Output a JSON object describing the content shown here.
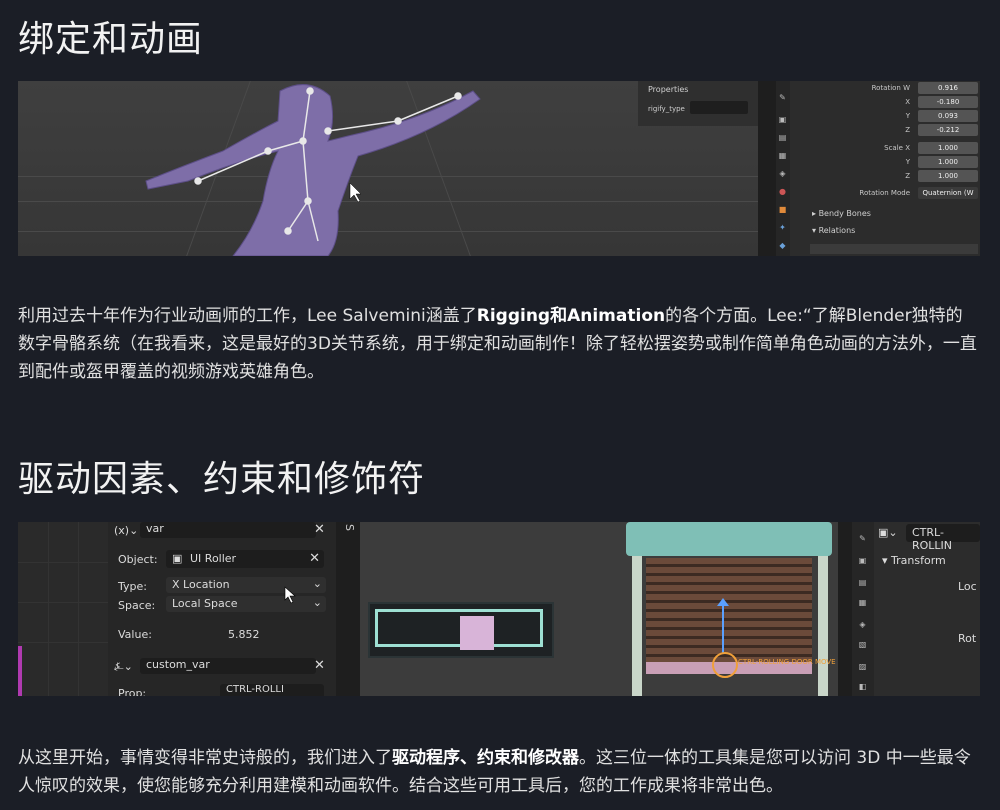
{
  "section1": {
    "heading": "绑定和动画",
    "screenshot": {
      "properties_panel": {
        "title": "Properties",
        "field_label": "rigify_type"
      },
      "transform": {
        "rotation_w_label": "Rotation W",
        "rotation_w": "0.916",
        "x_label": "X",
        "x": "-0.180",
        "y_label": "Y",
        "y": "0.093",
        "z_label": "Z",
        "z": "-0.212",
        "scale_x_label": "Scale X",
        "scale_x": "1.000",
        "scale_y_label": "Y",
        "scale_y": "1.000",
        "scale_z_label": "Z",
        "scale_z": "1.000",
        "rotation_mode_label": "Rotation Mode",
        "rotation_mode": "Quaternion (W"
      },
      "subsections": {
        "bendy_bones": "Bendy Bones",
        "relations": "Relations"
      }
    },
    "para_pre": "利用过去十年作为行业动画师的工作，Lee Salvemini涵盖了",
    "para_bold": "Rigging和Animation",
    "para_post": "的各个方面。Lee:“了解Blender独特的数字骨骼系统（在我看来，这是最好的3D关节系统，用于绑定和动画制作！除了轻松摆姿势或制作简单角色动画的方法外，一直到配件或盔甲覆盖的视频游戏英雄角色。"
  },
  "section2": {
    "heading": "驱动因素、约束和修饰符",
    "screenshot": {
      "driver": {
        "var_prefix": "(x)",
        "var_name": "var",
        "object_label": "Object:",
        "object_value": "UI Roller",
        "type_label": "Type:",
        "type_value": "X Location",
        "space_label": "Space:",
        "space_value": "Local Space",
        "value_label": "Value:",
        "value": "5.852",
        "var2_name": "custom_var",
        "prop_label": "Prop:",
        "prop_value": "CTRL-ROLLI"
      },
      "divider_letter": "S",
      "viewport": {
        "ctrl_label": "CTRL-ROLLING DOOR MOVE"
      },
      "side_panel": {
        "object_name": "CTRL-ROLLIN",
        "transform_header": "Transform",
        "loc": "Loc",
        "rot": "Rot"
      }
    },
    "para_pre": "从这里开始，事情变得非常史诗般的，我们进入了",
    "para_bold": "驱动程序、约束和修改器",
    "para_post": "。这三位一体的工具集是您可以访问 3D 中一些最令人惊叹的效果，使您能够充分利用建模和动画软件。结合这些可用工具后，您的工作成果将非常出色。"
  }
}
